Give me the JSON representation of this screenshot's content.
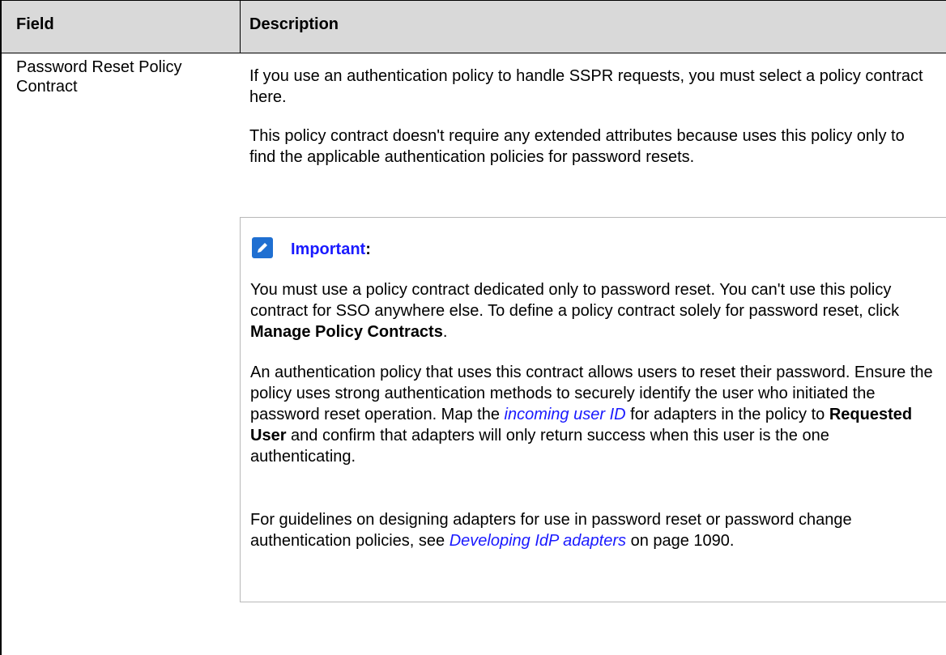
{
  "table": {
    "headers": {
      "field": "Field",
      "description": "Description"
    },
    "row": {
      "field_name_line1": "Password Reset Policy",
      "field_name_line2": "Contract",
      "desc_p1": "If you use an authentication policy to handle SSPR requests, you must select a policy contract here.",
      "desc_p2": "This policy contract doesn't require any extended attributes because uses this policy only to find the applicable authentication policies for password resets."
    }
  },
  "note": {
    "icon": "pencil-note-icon",
    "title": "Important",
    "title_colon": ":",
    "p1_text": "You must use a policy contract dedicated only to password reset. You can't use this policy contract for SSO anywhere else. To define a policy contract solely for password reset, click ",
    "p1_bold": "Manage Policy Contracts",
    "p1_end": ".",
    "p2_a": "An authentication policy that uses this contract allows users to reset their password. Ensure the policy uses strong authentication methods to securely identify the user who initiated the password reset operation. Map the ",
    "p2_link": "incoming user ID",
    "p2_b": " for adapters in the policy to ",
    "p2_bold": "Requested User",
    "p2_c": " and confirm that adapters will only return success when this user is the one authenticating.",
    "p3_a": "For guidelines on designing adapters for use in password reset or password change authentication policies, see ",
    "p3_link": "Developing IdP adapters",
    "p3_b": " on page 1090."
  },
  "colors": {
    "header_bg": "#d9d9d9",
    "link": "#1a1aff",
    "icon_bg": "#1f6fd1"
  }
}
